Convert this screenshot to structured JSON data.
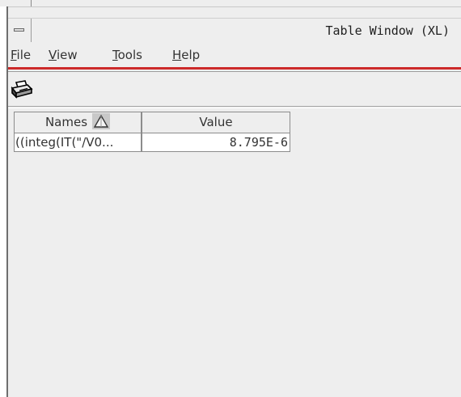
{
  "window": {
    "title": "Table Window (XL)"
  },
  "menu": [
    {
      "mnemonic": "F",
      "rest": "ile"
    },
    {
      "mnemonic": "V",
      "rest": "iew"
    },
    {
      "mnemonic": "T",
      "rest": "ools"
    },
    {
      "mnemonic": "H",
      "rest": "elp"
    }
  ],
  "toolbar": {
    "print_icon": "printer-icon"
  },
  "table": {
    "columns": [
      {
        "label": "Names",
        "sort_icon": "sort-ascending-icon"
      },
      {
        "label": "Value"
      }
    ],
    "rows": [
      {
        "name": "((integ(IT(\"/V0...",
        "value": "8.795E-6"
      }
    ]
  },
  "colors": {
    "menu_underline": "#cc2a2a",
    "background": "#eeeeee"
  }
}
